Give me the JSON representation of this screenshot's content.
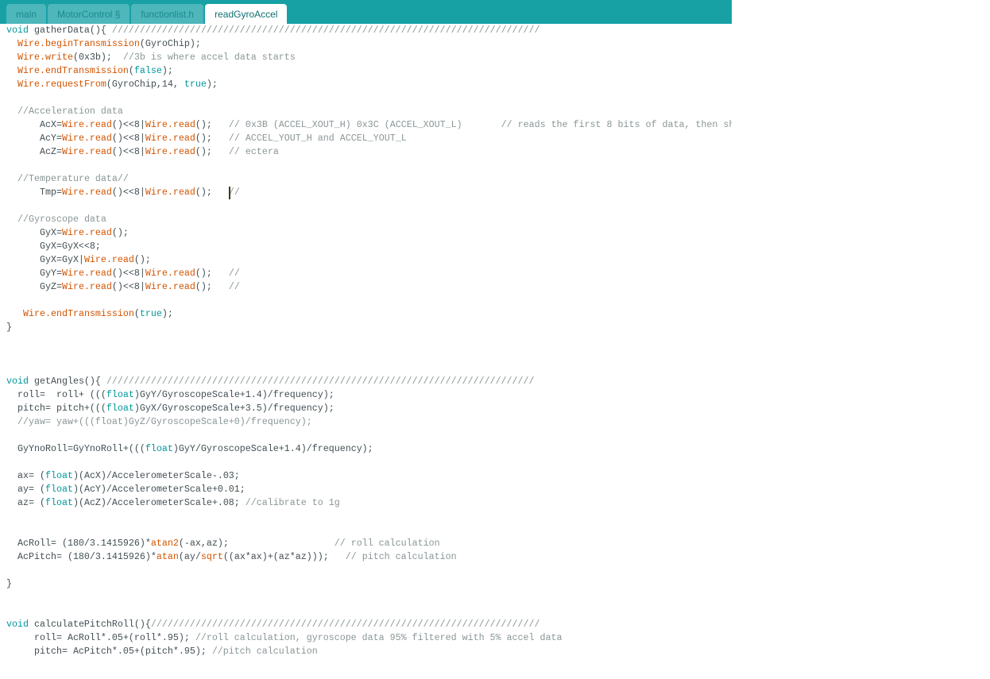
{
  "tabs": [
    {
      "label": "main",
      "active": false
    },
    {
      "label": "MotorControl §",
      "active": false
    },
    {
      "label": "functionlist.h",
      "active": false
    },
    {
      "label": "readGyroAccel",
      "active": true
    }
  ],
  "colors": {
    "tabbar": "#17a1a5",
    "keyword": "#00979c",
    "function": "#d35400",
    "comment": "#8a9697",
    "text": "#434f54"
  },
  "editor": {
    "cursor": {
      "line": 13,
      "column": 41
    },
    "lines": [
      {
        "tokens": [
          {
            "t": "kw",
            "s": "void"
          },
          {
            "t": "tx",
            "s": " gatherData(){ "
          },
          {
            "t": "cm",
            "s": "/////////////////////////////////////////////////////////////////////////////"
          }
        ]
      },
      {
        "tokens": [
          {
            "t": "tx",
            "s": "  "
          },
          {
            "t": "fn",
            "s": "Wire.beginTransmission"
          },
          {
            "t": "tx",
            "s": "(GyroChip);"
          }
        ]
      },
      {
        "tokens": [
          {
            "t": "tx",
            "s": "  "
          },
          {
            "t": "fn",
            "s": "Wire.write"
          },
          {
            "t": "tx",
            "s": "(0x3b);  "
          },
          {
            "t": "cm",
            "s": "//3b is where accel data starts"
          }
        ]
      },
      {
        "tokens": [
          {
            "t": "tx",
            "s": "  "
          },
          {
            "t": "fn",
            "s": "Wire.endTransmission"
          },
          {
            "t": "tx",
            "s": "("
          },
          {
            "t": "kw",
            "s": "false"
          },
          {
            "t": "tx",
            "s": ");"
          }
        ]
      },
      {
        "tokens": [
          {
            "t": "tx",
            "s": "  "
          },
          {
            "t": "fn",
            "s": "Wire.requestFrom"
          },
          {
            "t": "tx",
            "s": "(GyroChip,14, "
          },
          {
            "t": "kw",
            "s": "true"
          },
          {
            "t": "tx",
            "s": ");"
          }
        ]
      },
      {
        "tokens": []
      },
      {
        "tokens": [
          {
            "t": "tx",
            "s": "  "
          },
          {
            "t": "cm",
            "s": "//Acceleration data"
          }
        ]
      },
      {
        "tokens": [
          {
            "t": "tx",
            "s": "      AcX="
          },
          {
            "t": "fn",
            "s": "Wire.read"
          },
          {
            "t": "tx",
            "s": "()<<8|"
          },
          {
            "t": "fn",
            "s": "Wire.read"
          },
          {
            "t": "tx",
            "s": "();   "
          },
          {
            "t": "cm",
            "s": "// 0x3B (ACCEL_XOUT_H) 0x3C (ACCEL_XOUT_L)       // reads the first 8 bits of data, then sh"
          }
        ]
      },
      {
        "tokens": [
          {
            "t": "tx",
            "s": "      AcY="
          },
          {
            "t": "fn",
            "s": "Wire.read"
          },
          {
            "t": "tx",
            "s": "()<<8|"
          },
          {
            "t": "fn",
            "s": "Wire.read"
          },
          {
            "t": "tx",
            "s": "();   "
          },
          {
            "t": "cm",
            "s": "// ACCEL_YOUT_H and ACCEL_YOUT_L"
          }
        ]
      },
      {
        "tokens": [
          {
            "t": "tx",
            "s": "      AcZ="
          },
          {
            "t": "fn",
            "s": "Wire.read"
          },
          {
            "t": "tx",
            "s": "()<<8|"
          },
          {
            "t": "fn",
            "s": "Wire.read"
          },
          {
            "t": "tx",
            "s": "();   "
          },
          {
            "t": "cm",
            "s": "// ectera"
          }
        ]
      },
      {
        "tokens": []
      },
      {
        "tokens": [
          {
            "t": "tx",
            "s": "  "
          },
          {
            "t": "cm",
            "s": "//Temperature data//"
          }
        ]
      },
      {
        "tokens": [
          {
            "t": "tx",
            "s": "      Tmp="
          },
          {
            "t": "fn",
            "s": "Wire.read"
          },
          {
            "t": "tx",
            "s": "()<<8|"
          },
          {
            "t": "fn",
            "s": "Wire.read"
          },
          {
            "t": "tx",
            "s": "();   "
          },
          {
            "t": "cm",
            "s": "//"
          }
        ]
      },
      {
        "tokens": []
      },
      {
        "tokens": [
          {
            "t": "tx",
            "s": "  "
          },
          {
            "t": "cm",
            "s": "//Gyroscope data"
          }
        ]
      },
      {
        "tokens": [
          {
            "t": "tx",
            "s": "      GyX="
          },
          {
            "t": "fn",
            "s": "Wire.read"
          },
          {
            "t": "tx",
            "s": "();"
          }
        ]
      },
      {
        "tokens": [
          {
            "t": "tx",
            "s": "      GyX=GyX<<8;"
          }
        ]
      },
      {
        "tokens": [
          {
            "t": "tx",
            "s": "      GyX=GyX|"
          },
          {
            "t": "fn",
            "s": "Wire.read"
          },
          {
            "t": "tx",
            "s": "();"
          }
        ]
      },
      {
        "tokens": [
          {
            "t": "tx",
            "s": "      GyY="
          },
          {
            "t": "fn",
            "s": "Wire.read"
          },
          {
            "t": "tx",
            "s": "()<<8|"
          },
          {
            "t": "fn",
            "s": "Wire.read"
          },
          {
            "t": "tx",
            "s": "();   "
          },
          {
            "t": "cm",
            "s": "//"
          }
        ]
      },
      {
        "tokens": [
          {
            "t": "tx",
            "s": "      GyZ="
          },
          {
            "t": "fn",
            "s": "Wire.read"
          },
          {
            "t": "tx",
            "s": "()<<8|"
          },
          {
            "t": "fn",
            "s": "Wire.read"
          },
          {
            "t": "tx",
            "s": "();   "
          },
          {
            "t": "cm",
            "s": "//"
          }
        ]
      },
      {
        "tokens": []
      },
      {
        "tokens": [
          {
            "t": "tx",
            "s": "   "
          },
          {
            "t": "fn",
            "s": "Wire.endTransmission"
          },
          {
            "t": "tx",
            "s": "("
          },
          {
            "t": "kw",
            "s": "true"
          },
          {
            "t": "tx",
            "s": ");"
          }
        ]
      },
      {
        "tokens": [
          {
            "t": "tx",
            "s": "}"
          }
        ]
      },
      {
        "tokens": []
      },
      {
        "tokens": []
      },
      {
        "tokens": []
      },
      {
        "tokens": [
          {
            "t": "kw",
            "s": "void"
          },
          {
            "t": "tx",
            "s": " getAngles(){ "
          },
          {
            "t": "cm",
            "s": "/////////////////////////////////////////////////////////////////////////////"
          }
        ]
      },
      {
        "tokens": [
          {
            "t": "tx",
            "s": "  roll=  roll+ ((("
          },
          {
            "t": "kw",
            "s": "float"
          },
          {
            "t": "tx",
            "s": ")GyY/GyroscopeScale+1.4)/frequency);"
          }
        ]
      },
      {
        "tokens": [
          {
            "t": "tx",
            "s": "  pitch= pitch+((("
          },
          {
            "t": "kw",
            "s": "float"
          },
          {
            "t": "tx",
            "s": ")GyX/GyroscopeScale+3.5)/frequency);"
          }
        ]
      },
      {
        "tokens": [
          {
            "t": "tx",
            "s": "  "
          },
          {
            "t": "cm",
            "s": "//yaw= yaw+(((float)GyZ/GyroscopeScale+0)/frequency);"
          }
        ]
      },
      {
        "tokens": []
      },
      {
        "tokens": [
          {
            "t": "tx",
            "s": "  GyYnoRoll=GyYnoRoll+((("
          },
          {
            "t": "kw",
            "s": "float"
          },
          {
            "t": "tx",
            "s": ")GyY/GyroscopeScale+1.4)/frequency);"
          }
        ]
      },
      {
        "tokens": []
      },
      {
        "tokens": [
          {
            "t": "tx",
            "s": "  ax= ("
          },
          {
            "t": "kw",
            "s": "float"
          },
          {
            "t": "tx",
            "s": ")(AcX)/AccelerometerScale-.03;"
          }
        ]
      },
      {
        "tokens": [
          {
            "t": "tx",
            "s": "  ay= ("
          },
          {
            "t": "kw",
            "s": "float"
          },
          {
            "t": "tx",
            "s": ")(AcY)/AccelerometerScale+0.01;"
          }
        ]
      },
      {
        "tokens": [
          {
            "t": "tx",
            "s": "  az= ("
          },
          {
            "t": "kw",
            "s": "float"
          },
          {
            "t": "tx",
            "s": ")(AcZ)/AccelerometerScale+.08; "
          },
          {
            "t": "cm",
            "s": "//calibrate to 1g"
          }
        ]
      },
      {
        "tokens": []
      },
      {
        "tokens": []
      },
      {
        "tokens": [
          {
            "t": "tx",
            "s": "  AcRoll= (180/3.1415926)*"
          },
          {
            "t": "fn",
            "s": "atan2"
          },
          {
            "t": "tx",
            "s": "(-ax,az);                   "
          },
          {
            "t": "cm",
            "s": "// roll calculation"
          }
        ]
      },
      {
        "tokens": [
          {
            "t": "tx",
            "s": "  AcPitch= (180/3.1415926)*"
          },
          {
            "t": "fn",
            "s": "atan"
          },
          {
            "t": "tx",
            "s": "(ay/"
          },
          {
            "t": "fn",
            "s": "sqrt"
          },
          {
            "t": "tx",
            "s": "((ax*ax)+(az*az)));   "
          },
          {
            "t": "cm",
            "s": "// pitch calculation"
          }
        ]
      },
      {
        "tokens": []
      },
      {
        "tokens": [
          {
            "t": "tx",
            "s": "}"
          }
        ]
      },
      {
        "tokens": []
      },
      {
        "tokens": []
      },
      {
        "tokens": [
          {
            "t": "kw",
            "s": "void"
          },
          {
            "t": "tx",
            "s": " calculatePitchRoll(){"
          },
          {
            "t": "cm",
            "s": "//////////////////////////////////////////////////////////////////////"
          }
        ]
      },
      {
        "tokens": [
          {
            "t": "tx",
            "s": "     roll= AcRoll*.05+(roll*.95); "
          },
          {
            "t": "cm",
            "s": "//roll calculation, gyroscope data 95% filtered with 5% accel data"
          }
        ]
      },
      {
        "tokens": [
          {
            "t": "tx",
            "s": "     pitch= AcPitch*.05+(pitch*.95); "
          },
          {
            "t": "cm",
            "s": "//pitch calculation"
          }
        ]
      }
    ]
  }
}
